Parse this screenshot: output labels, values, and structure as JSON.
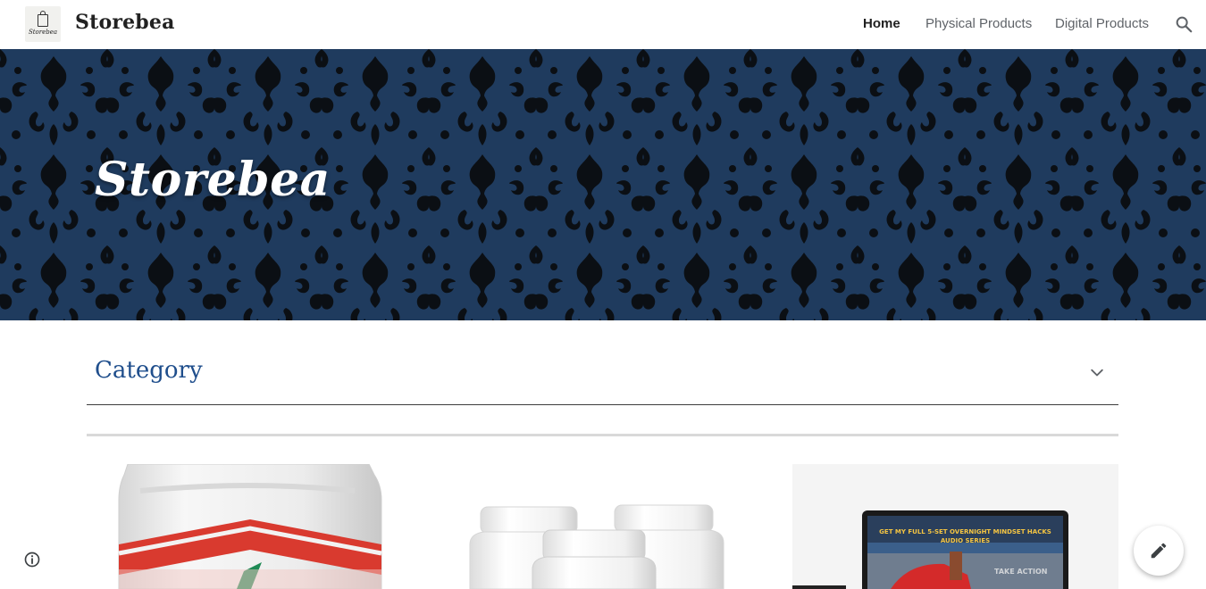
{
  "header": {
    "logo_text": "Storebea",
    "site_title": "Storebea",
    "nav": [
      {
        "label": "Home",
        "active": true
      },
      {
        "label": "Physical Products",
        "active": false
      },
      {
        "label": "Digital Products",
        "active": false
      }
    ],
    "search_icon": "search-icon"
  },
  "banner": {
    "title": "Storebea",
    "background_color": "#1f3b5e"
  },
  "category": {
    "label": "Category",
    "toggle_icon": "chevron-down-icon",
    "label_color": "#1f4e8c"
  },
  "products": [
    {
      "image": "supplement-jar-red-label"
    },
    {
      "image": "three-white-supplement-bottles"
    },
    {
      "image": "laptop-mindset-audio-promo",
      "screen_text": "GET MY FULL 5-SET OVERNIGHT MINDSET HACKS AUDIO SERIES",
      "button_text": "TAKE ACTION"
    }
  ],
  "footer": {
    "info_icon": "info-icon",
    "edit_icon": "pencil-icon"
  }
}
